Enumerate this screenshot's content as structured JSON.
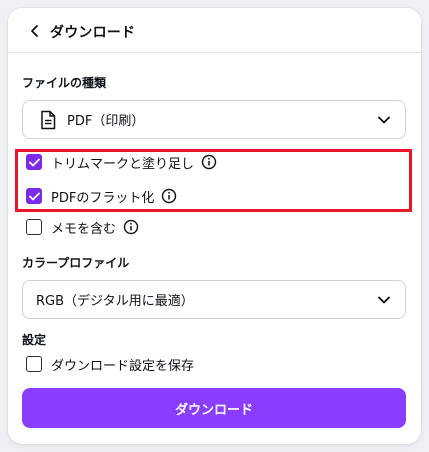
{
  "header": {
    "title": "ダウンロード",
    "back_icon": "chevron-left-icon"
  },
  "file_type": {
    "label": "ファイルの種類",
    "selected": "PDF（印刷）",
    "icon": "document-icon"
  },
  "options": {
    "crop_marks": {
      "label": "トリムマークと塗り足し",
      "checked": true
    },
    "flatten_pdf": {
      "label": "PDFのフラット化",
      "checked": true
    },
    "include_notes": {
      "label": "メモを含む",
      "checked": false
    }
  },
  "color_profile": {
    "label": "カラープロファイル",
    "selected": "RGB（デジタル用に最適）"
  },
  "settings": {
    "label": "設定",
    "save_settings": {
      "label": "ダウンロード設定を保存",
      "checked": false
    }
  },
  "download_button": {
    "label": "ダウンロード"
  },
  "colors": {
    "accent": "#8b3dff",
    "checkbox": "#7d2ae8",
    "highlight_border": "#e8162a"
  }
}
